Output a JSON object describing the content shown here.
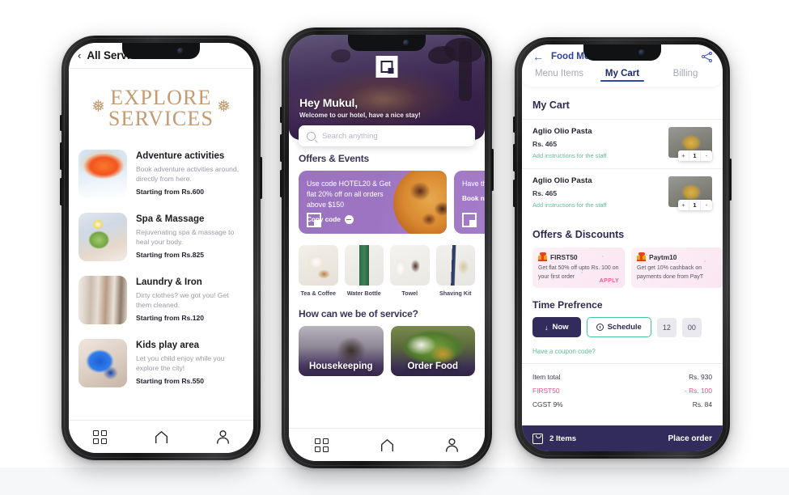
{
  "phone1": {
    "header": {
      "back_icon": "chevron-left-icon",
      "title": "All Services"
    },
    "hero": {
      "line1": "EXPLORE",
      "line2": "SERVICES"
    },
    "services": [
      {
        "name": "Adventure activities",
        "desc": "Book adventure activities around, directly from here.",
        "price": "Starting from Rs.600",
        "thumb": "paragliding-photo"
      },
      {
        "name": "Spa & Massage",
        "desc": "Rejuvenating spa & massage to heal your body.",
        "price": "Starting from Rs.825",
        "thumb": "spa-photo"
      },
      {
        "name": "Laundry & Iron",
        "desc": "Dirty clothes? we got you! Get them cleaned.",
        "price": "Starting from Rs.120",
        "thumb": "laundry-photo"
      },
      {
        "name": "Kids play area",
        "desc": "Let you child enjoy while you explore the city!",
        "price": "Starting from Rs.550",
        "thumb": "kids-paint-photo"
      }
    ],
    "navbar": [
      {
        "icon": "grid-icon",
        "label": ""
      },
      {
        "icon": "home-icon",
        "label": ""
      },
      {
        "icon": "person-icon",
        "label": ""
      }
    ]
  },
  "phone2": {
    "hero": {
      "logo_icon": "hotel-logo-icon",
      "greeting": "Hey Mukul,",
      "subtitle": "Welcome to our hotel, have a nice stay!"
    },
    "search": {
      "icon": "search-icon",
      "placeholder": "Search anything"
    },
    "offers_section_title": "Offers & Events",
    "offers": [
      {
        "text": "Use code HOTEL20 & Get flat 20% off on all orders above $150",
        "cta": "Copy code",
        "cta_icon": "arrow-right-circle-icon",
        "logo_icon": "hotel-logo-icon"
      },
      {
        "text": "Have th Dive fr experie",
        "cta": "Book no",
        "cta_icon": "arrow-right-circle-icon",
        "logo_icon": "hotel-logo-icon"
      }
    ],
    "amenities": [
      {
        "label": "Tea & Coffee",
        "image": "tea-coffee-photo"
      },
      {
        "label": "Water Bottle",
        "image": "water-bottle-photo"
      },
      {
        "label": "Towel",
        "image": "towel-photo"
      },
      {
        "label": "Shaving Kit",
        "image": "shaving-kit-photo"
      }
    ],
    "service_section_title": "How can we be of service?",
    "service_cards": [
      {
        "label": "Housekeeping",
        "image": "housekeeping-photo"
      },
      {
        "label": "Order Food",
        "image": "order-food-photo"
      }
    ],
    "navbar": [
      {
        "icon": "grid-icon"
      },
      {
        "icon": "home-icon"
      },
      {
        "icon": "person-icon"
      }
    ]
  },
  "phone3": {
    "nav": {
      "back_icon": "arrow-left-icon",
      "title": "Food Menu",
      "share_icon": "share-icon"
    },
    "tabs": [
      {
        "label": "Menu Items",
        "active": false
      },
      {
        "label": "My Cart",
        "active": true
      },
      {
        "label": "Billing",
        "active": false
      }
    ],
    "cart_heading": "My Cart",
    "cart_items": [
      {
        "name": "Aglio Olio Pasta",
        "price": "Rs. 465",
        "note": "Add instructions for the staff",
        "qty": "1",
        "plus": "+",
        "minus": "-",
        "image": "pasta-photo"
      },
      {
        "name": "Aglio Olio Pasta",
        "price": "Rs. 465",
        "note": "Add instructions for the staff",
        "qty": "1",
        "plus": "+",
        "minus": "-",
        "image": "pasta-photo"
      }
    ],
    "offers_heading": "Offers & Discounts",
    "offers": [
      {
        "code": "FIRST50",
        "desc": "Get flat 50% off upto Rs. 100 on your first order",
        "apply": "APPLY",
        "icon": "gift-icon"
      },
      {
        "code": "Paytm10",
        "desc": "Get get 10% cashback on payments done from PayT",
        "apply": "",
        "icon": "gift-icon"
      }
    ],
    "time_heading": "Time Prefrence",
    "time": {
      "now_label": "Now",
      "now_icon": "arrow-down-icon",
      "schedule_label": "Schedule",
      "schedule_icon": "clock-icon",
      "hour": "12",
      "minute": "00"
    },
    "coupon_link": "Have a coupon code?",
    "bill": [
      {
        "label": "Item total",
        "value": "Rs. 930",
        "discount": false
      },
      {
        "label": "FIRST50",
        "value": "- Rs. 100",
        "discount": true
      },
      {
        "label": "CGST 9%",
        "value": "Rs. 84",
        "discount": false
      }
    ],
    "orderbar": {
      "bag_icon": "bag-icon",
      "items": "2 Items",
      "cta": "Place order"
    }
  },
  "colors": {
    "accent_purple": "#312c5c",
    "tan": "#c49a70",
    "tab_blue": "#2e44ab",
    "green": "#5fbd9a",
    "pink": "#ef5b9c",
    "offer_purple": "#9b73c0"
  }
}
